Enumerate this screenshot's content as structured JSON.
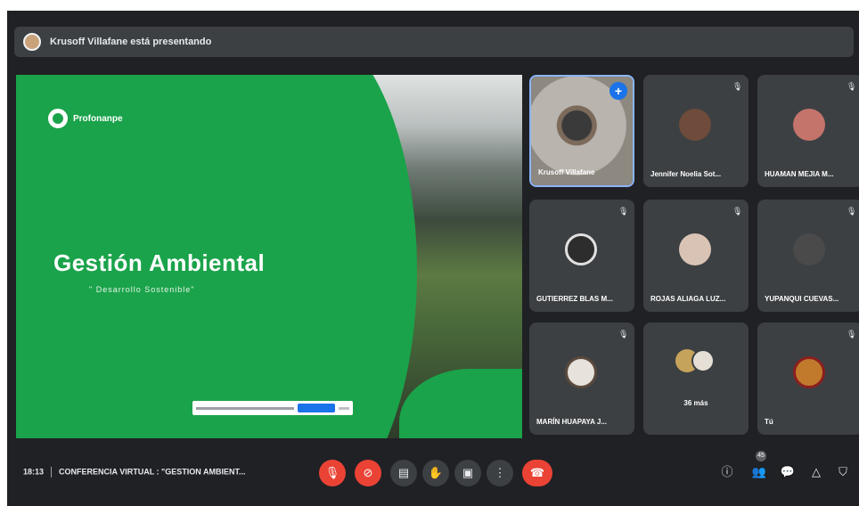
{
  "banner": {
    "text": "Krusoff Villafane está presentando"
  },
  "slide": {
    "brand": "Profonanpe",
    "title": "Gestión Ambiental",
    "subtitle": "\" Desarrollo Sostenible\""
  },
  "participants": [
    {
      "name": "Krusoff Villafane",
      "self_view": true
    },
    {
      "name": "Jennifer Noelia Sot...",
      "muted": true
    },
    {
      "name": "HUAMAN MEJIA M...",
      "muted": true
    },
    {
      "name": "GUTIERREZ BLAS M...",
      "muted": true
    },
    {
      "name": "ROJAS ALIAGA LUZ...",
      "muted": true
    },
    {
      "name": "YUPANQUI CUEVAS...",
      "muted": true
    },
    {
      "name": "MARÍN HUAPAYA J...",
      "muted": true
    },
    {
      "name": "",
      "more_label": "36 más"
    },
    {
      "name": "Tú",
      "muted": true
    }
  ],
  "bottom_bar": {
    "time": "18:13",
    "meeting_title": "CONFERENCIA VIRTUAL : \"GESTION AMBIENT...",
    "people_count": "45"
  },
  "colors": {
    "slide_green": "#1aa34a",
    "mute_red": "#ea4335",
    "pin_blue": "#1a73e8"
  },
  "icons": {
    "controls": [
      "mic-off-icon",
      "camera-off-icon",
      "captions-icon",
      "raise-hand-icon",
      "present-icon",
      "more-options-icon",
      "end-call-icon"
    ],
    "right": [
      "info-icon",
      "people-icon",
      "chat-icon",
      "activities-icon",
      "host-controls-icon"
    ]
  }
}
